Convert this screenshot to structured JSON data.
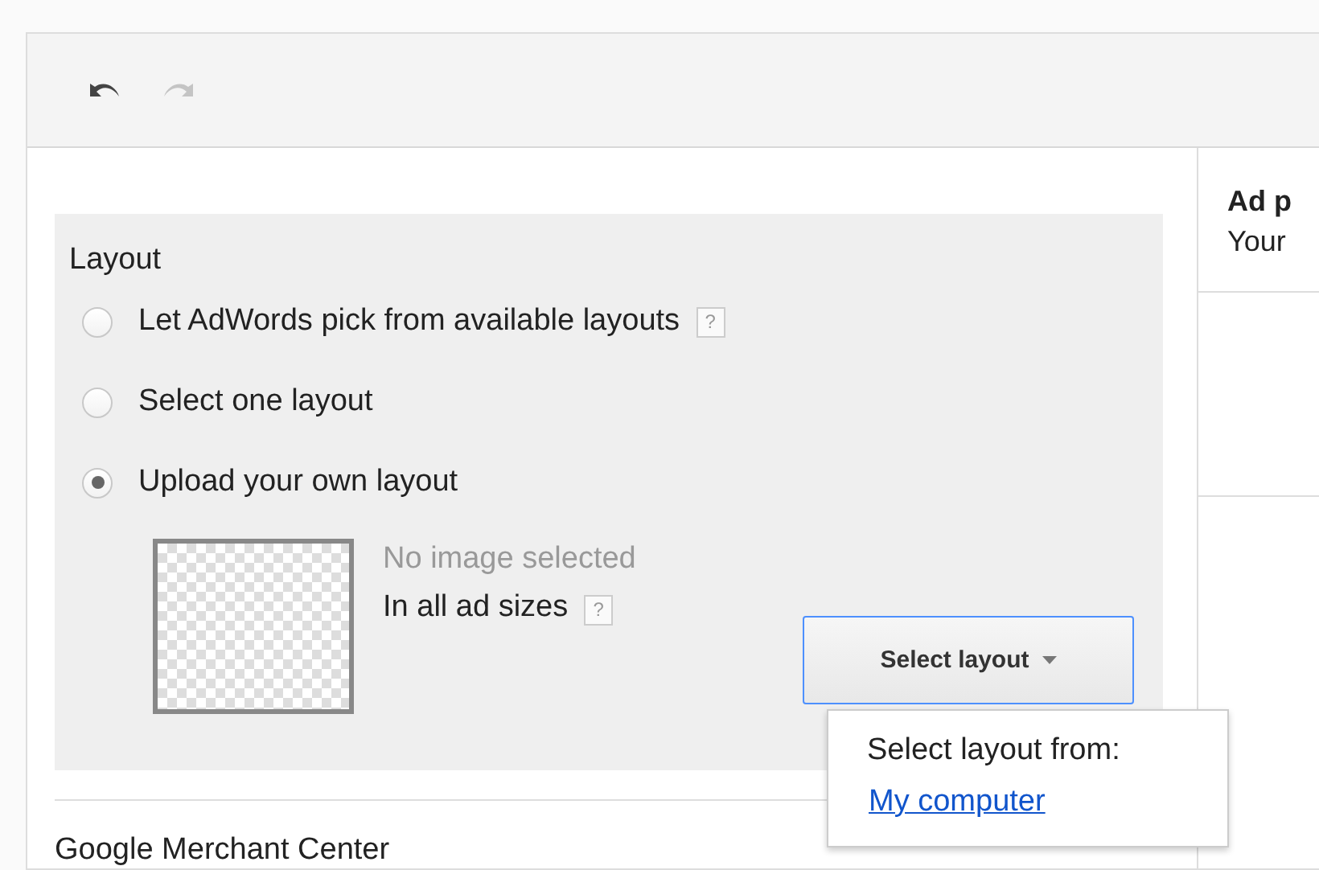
{
  "toolbar": {
    "buttons": [
      {
        "kind": "undo",
        "disabled": false
      },
      {
        "kind": "redo",
        "disabled": true
      }
    ]
  },
  "layout_section": {
    "title": "Layout",
    "options": [
      {
        "label": "Let AdWords pick from available layouts",
        "help": "?",
        "selected": false
      },
      {
        "label": "Select one layout",
        "selected": false
      },
      {
        "label": "Upload your own layout",
        "selected": true
      }
    ],
    "upload": {
      "status": "No image selected",
      "sizes": "In all ad sizes",
      "help": "?",
      "button": "Select layout",
      "menu": {
        "title": "Select layout from:",
        "items": [
          "My computer"
        ]
      }
    }
  },
  "next_section": {
    "title": "Google Merchant Center"
  },
  "side_panel": {
    "title": "Ad p",
    "text": "Your"
  }
}
